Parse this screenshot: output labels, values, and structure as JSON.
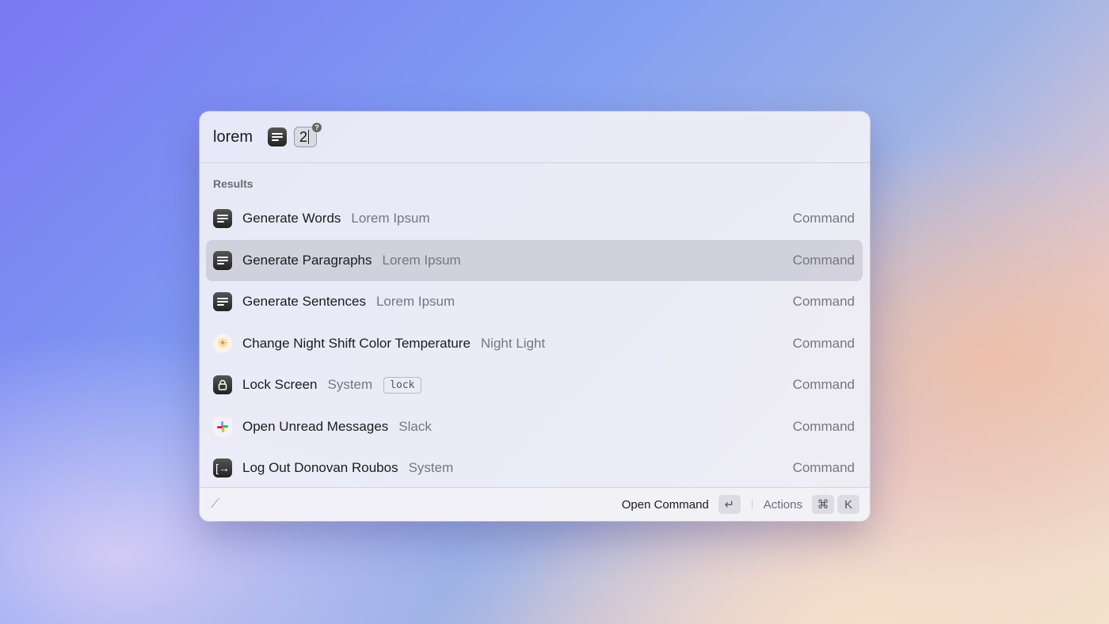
{
  "search": {
    "query": "lorem",
    "argument": "2",
    "help": "?"
  },
  "section_title": "Results",
  "results": [
    {
      "title": "Generate Words",
      "subtitle": "Lorem Ipsum",
      "type": "Command",
      "icon": "text-lines-icon"
    },
    {
      "title": "Generate Paragraphs",
      "subtitle": "Lorem Ipsum",
      "type": "Command",
      "icon": "text-lines-icon",
      "selected": true
    },
    {
      "title": "Generate Sentences",
      "subtitle": "Lorem Ipsum",
      "type": "Command",
      "icon": "text-lines-icon"
    },
    {
      "title": "Change Night Shift Color Temperature",
      "subtitle": "Night Light",
      "type": "Command",
      "icon": "sun-icon"
    },
    {
      "title": "Lock Screen",
      "subtitle": "System",
      "tag": "lock",
      "type": "Command",
      "icon": "lock-icon"
    },
    {
      "title": "Open Unread Messages",
      "subtitle": "Slack",
      "type": "Command",
      "icon": "slack-icon"
    },
    {
      "title": "Log Out Donovan Roubos",
      "subtitle": "System",
      "type": "Command",
      "icon": "logout-icon"
    }
  ],
  "footer": {
    "primary_action": "Open Command",
    "primary_key": "↵",
    "actions_label": "Actions",
    "actions_keys": [
      "⌘",
      "K"
    ]
  }
}
